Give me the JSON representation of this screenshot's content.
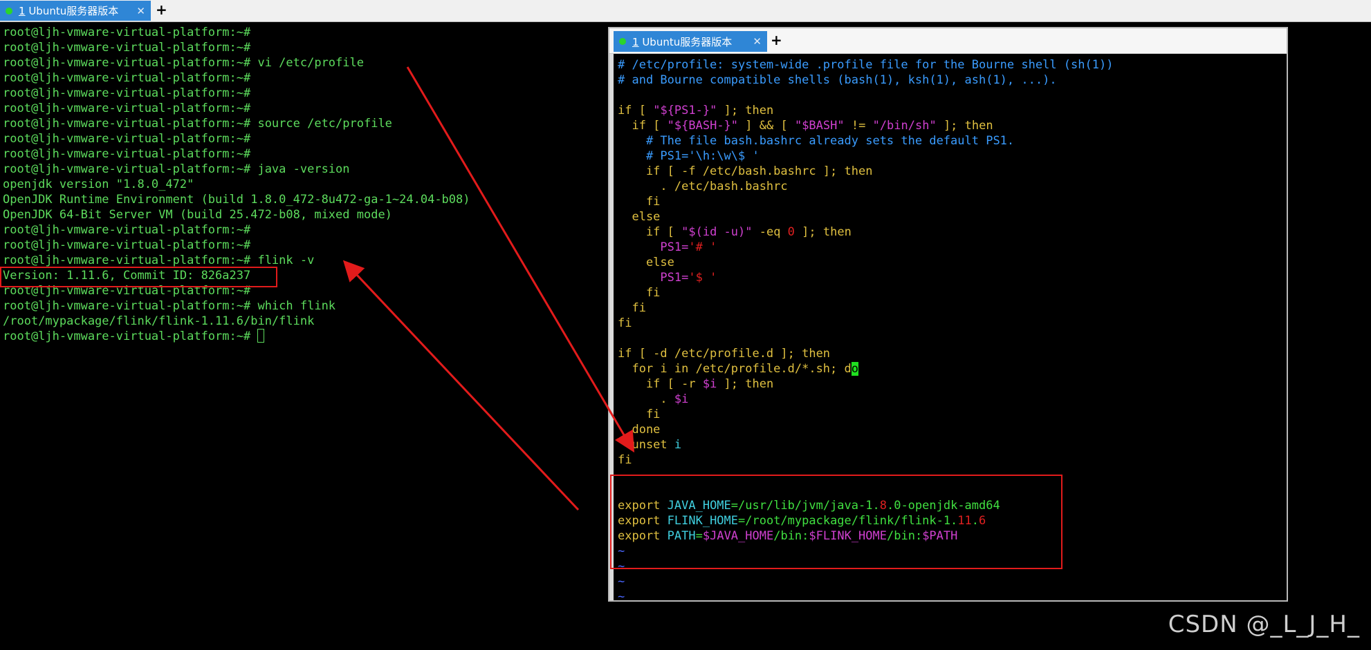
{
  "tabbar": {
    "tab_num": "1",
    "tab_title": " Ubuntu服务器版本",
    "close": "✕",
    "plus": "+"
  },
  "terminal": {
    "lines": [
      {
        "text": "root@ljh-vmware-virtual-platform:~#"
      },
      {
        "text": "root@ljh-vmware-virtual-platform:~#"
      },
      {
        "text": "root@ljh-vmware-virtual-platform:~# vi /etc/profile"
      },
      {
        "text": "root@ljh-vmware-virtual-platform:~#"
      },
      {
        "text": "root@ljh-vmware-virtual-platform:~#"
      },
      {
        "text": "root@ljh-vmware-virtual-platform:~#"
      },
      {
        "text": "root@ljh-vmware-virtual-platform:~# source /etc/profile"
      },
      {
        "text": "root@ljh-vmware-virtual-platform:~#"
      },
      {
        "text": "root@ljh-vmware-virtual-platform:~#"
      },
      {
        "text": "root@ljh-vmware-virtual-platform:~# java -version"
      },
      {
        "text": "openjdk version \"1.8.0_472\""
      },
      {
        "text": "OpenJDK Runtime Environment (build 1.8.0_472-8u472-ga-1~24.04-b08)"
      },
      {
        "text": "OpenJDK 64-Bit Server VM (build 25.472-b08, mixed mode)"
      },
      {
        "text": "root@ljh-vmware-virtual-platform:~#"
      },
      {
        "text": "root@ljh-vmware-virtual-platform:~#"
      },
      {
        "text": "root@ljh-vmware-virtual-platform:~# flink -v"
      },
      {
        "text": "Version: 1.11.6, Commit ID: 826a237"
      },
      {
        "text": "root@ljh-vmware-virtual-platform:~#"
      },
      {
        "text": "root@ljh-vmware-virtual-platform:~# which flink"
      },
      {
        "text": "/root/mypackage/flink/flink-1.11.6/bin/flink"
      },
      {
        "text": "root@ljh-vmware-virtual-platform:~# "
      }
    ]
  },
  "editor_window": {
    "tab_num": "1",
    "tab_title": " Ubuntu服务器版本",
    "close": "✕",
    "plus": "+",
    "lines": [
      [
        {
          "t": "# /etc/profile: system-wide .profile file for the Bourne shell (sh(1))",
          "c": "com"
        }
      ],
      [
        {
          "t": "# and Bourne compatible shells (bash(1), ksh(1), ash(1), ...).",
          "c": "com"
        }
      ],
      [],
      [
        {
          "t": "if",
          "c": "kw"
        },
        {
          "t": " [ ",
          "c": "kw"
        },
        {
          "t": "\"",
          "c": "str"
        },
        {
          "t": "${PS1-}",
          "c": "var"
        },
        {
          "t": "\"",
          "c": "str"
        },
        {
          "t": " ]; then",
          "c": "kw"
        }
      ],
      [
        {
          "t": "  if [ ",
          "c": "kw"
        },
        {
          "t": "\"",
          "c": "str"
        },
        {
          "t": "${BASH-}",
          "c": "var"
        },
        {
          "t": "\"",
          "c": "str"
        },
        {
          "t": " ] && [ ",
          "c": "kw"
        },
        {
          "t": "\"",
          "c": "str"
        },
        {
          "t": "$BASH",
          "c": "var"
        },
        {
          "t": "\"",
          "c": "str"
        },
        {
          "t": " != ",
          "c": "kw"
        },
        {
          "t": "\"/bin/sh\"",
          "c": "str"
        },
        {
          "t": " ]; then",
          "c": "kw"
        }
      ],
      [
        {
          "t": "    # The file bash.bashrc already sets the default PS1.",
          "c": "com"
        }
      ],
      [
        {
          "t": "    # PS1='\\h:\\w\\$ '",
          "c": "com"
        }
      ],
      [
        {
          "t": "    if [ -f /etc/bash.bashrc ]; then",
          "c": "kw"
        }
      ],
      [
        {
          "t": "      . /etc/bash.bashrc",
          "c": "kw"
        }
      ],
      [
        {
          "t": "    fi",
          "c": "kw"
        }
      ],
      [
        {
          "t": "  else",
          "c": "kw"
        }
      ],
      [
        {
          "t": "    if [ ",
          "c": "kw"
        },
        {
          "t": "\"$(id -u)\"",
          "c": "str"
        },
        {
          "t": " -eq ",
          "c": "kw"
        },
        {
          "t": "0",
          "c": "num"
        },
        {
          "t": " ]; then",
          "c": "kw"
        }
      ],
      [
        {
          "t": "      ",
          "c": "kw"
        },
        {
          "t": "PS1=",
          "c": "str"
        },
        {
          "t": "'# '",
          "c": "num"
        }
      ],
      [
        {
          "t": "    else",
          "c": "kw"
        }
      ],
      [
        {
          "t": "      ",
          "c": "kw"
        },
        {
          "t": "PS1=",
          "c": "str"
        },
        {
          "t": "'$ '",
          "c": "num"
        }
      ],
      [
        {
          "t": "    fi",
          "c": "kw"
        }
      ],
      [
        {
          "t": "  fi",
          "c": "kw"
        }
      ],
      [
        {
          "t": "fi",
          "c": "kw"
        }
      ],
      [],
      [
        {
          "t": "if [ -d /etc/profile.d ]; then",
          "c": "kw"
        }
      ],
      [
        {
          "t": "  for i in /etc/profile.d/*.sh; d",
          "c": "kw"
        },
        {
          "t": "o",
          "c": "cursor"
        }
      ],
      [
        {
          "t": "    if [ -r ",
          "c": "kw"
        },
        {
          "t": "$i",
          "c": "var"
        },
        {
          "t": " ]; then",
          "c": "kw"
        }
      ],
      [
        {
          "t": "      . ",
          "c": "kw"
        },
        {
          "t": "$i",
          "c": "var"
        }
      ],
      [
        {
          "t": "    fi",
          "c": "kw"
        }
      ],
      [
        {
          "t": "  done",
          "c": "kw"
        }
      ],
      [
        {
          "t": "  unset ",
          "c": "kw"
        },
        {
          "t": "i",
          "c": "cy"
        }
      ],
      [
        {
          "t": "fi",
          "c": "kw"
        }
      ],
      [],
      [],
      [
        {
          "t": "export ",
          "c": "kw"
        },
        {
          "t": "JAVA_HOME",
          "c": "cy"
        },
        {
          "t": "=/usr/lib/jvm/java-1.",
          "c": "gr"
        },
        {
          "t": "8",
          "c": "num"
        },
        {
          "t": ".0-openjdk-amd64",
          "c": "gr"
        }
      ],
      [
        {
          "t": "export ",
          "c": "kw"
        },
        {
          "t": "FLINK_HOME",
          "c": "cy"
        },
        {
          "t": "=/root/mypackage/flink/flink-1.",
          "c": "gr"
        },
        {
          "t": "11",
          "c": "num"
        },
        {
          "t": ".",
          "c": "gr"
        },
        {
          "t": "6",
          "c": "num"
        }
      ],
      [
        {
          "t": "export ",
          "c": "kw"
        },
        {
          "t": "PATH",
          "c": "cy"
        },
        {
          "t": "=",
          "c": "gr"
        },
        {
          "t": "$JAVA_HOME",
          "c": "var"
        },
        {
          "t": "/bin:",
          "c": "gr"
        },
        {
          "t": "$FLINK_HOME",
          "c": "var"
        },
        {
          "t": "/bin:",
          "c": "gr"
        },
        {
          "t": "$PATH",
          "c": "var"
        }
      ],
      [
        {
          "t": "~",
          "c": "tilde"
        }
      ],
      [
        {
          "t": "~",
          "c": "tilde"
        }
      ],
      [
        {
          "t": "~",
          "c": "tilde"
        }
      ],
      [
        {
          "t": "~",
          "c": "tilde"
        }
      ]
    ]
  },
  "watermark": "CSDN @_L_J_H_",
  "colors": {
    "terminal_text": "#5ddc5d",
    "tab_active": "#2f86d6",
    "annotation_red": "#e21b1b"
  }
}
